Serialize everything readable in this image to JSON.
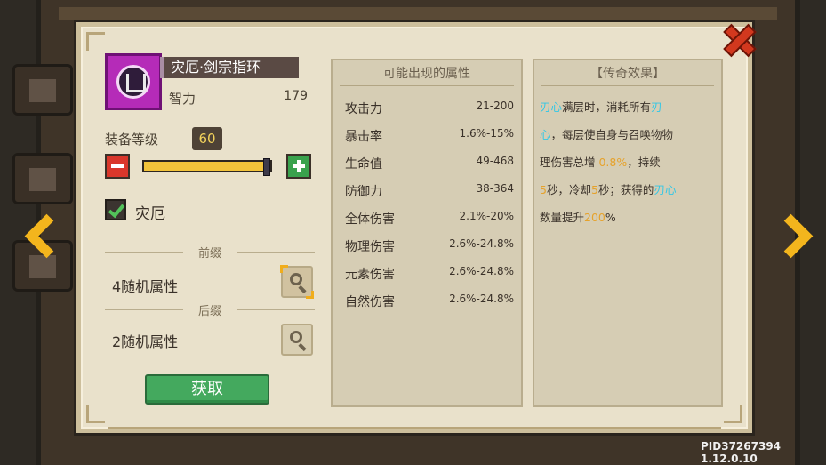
{
  "item": {
    "name": "灾厄·剑宗指环",
    "stat_label": "智力",
    "stat_value": "179"
  },
  "level": {
    "label": "装备等级",
    "value": "60",
    "progress": 1.0
  },
  "curse_checkbox": {
    "label": "灾厄",
    "checked": true
  },
  "prefix": {
    "divider": "前缀",
    "text": "4随机属性"
  },
  "suffix": {
    "divider": "后缀",
    "text": "2随机属性"
  },
  "get_button": "获取",
  "properties": {
    "title": "可能出现的属性",
    "rows": [
      {
        "name": "攻击力",
        "value": "21-200"
      },
      {
        "name": "暴击率",
        "value": "1.6%-15%"
      },
      {
        "name": "生命值",
        "value": "49-468"
      },
      {
        "name": "防御力",
        "value": "38-364"
      },
      {
        "name": "全体伤害",
        "value": "2.1%-20%"
      },
      {
        "name": "物理伤害",
        "value": "2.6%-24.8%"
      },
      {
        "name": "元素伤害",
        "value": "2.6%-24.8%"
      },
      {
        "name": "自然伤害",
        "value": "2.6%-24.8%"
      }
    ]
  },
  "legendary": {
    "title": "【传奇效果】",
    "line1": {
      "a": "刃心",
      "b": "满层时，消耗所有",
      "c": "刃"
    },
    "line2": {
      "a": "心",
      "b": "，每层使自身与召唤物物"
    },
    "line3": {
      "a": "理伤害总增 ",
      "b": "0.8%",
      "c": "，持续"
    },
    "line4": {
      "a": "5",
      "b": "秒，冷却",
      "c": "5",
      "d": "秒；获得的",
      "e": "刃心"
    },
    "line5": {
      "a": "数量提升",
      "b": "200",
      "c": "%"
    }
  },
  "footer": {
    "pid": "PID37267394 1.12.0.10"
  },
  "colors": {
    "accent_cyan": "#33c7e6",
    "accent_gold": "#e6a22b",
    "button_green": "#44a95e"
  }
}
